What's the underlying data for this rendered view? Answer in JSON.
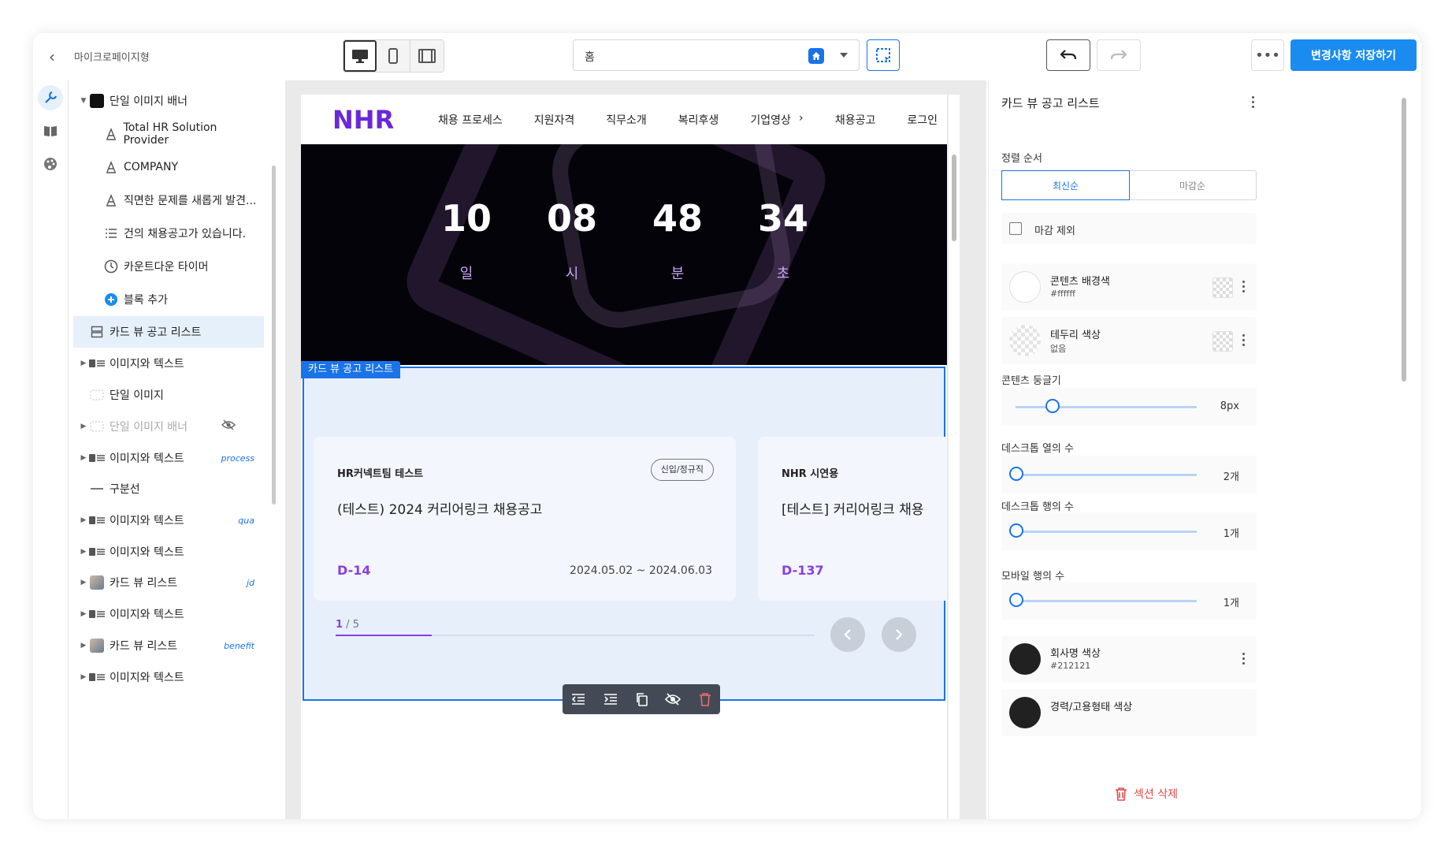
{
  "topbar": {
    "page_name": "마이크로페이지형",
    "page_select": "홈",
    "save_label": "변경사항 저장하기"
  },
  "tree": {
    "items": [
      {
        "label": "단일 이미지 배너",
        "icon": "image-thumbnail-icon"
      },
      {
        "label": "Total HR Solution Provider",
        "icon": "text-icon"
      },
      {
        "label": "COMPANY",
        "icon": "text-icon"
      },
      {
        "label": "직면한 문제를 새롭게 발견...",
        "icon": "text-icon"
      },
      {
        "label": "건의 채용공고가 있습니다.",
        "icon": "list-icon"
      },
      {
        "label": "카운트다운 타이머",
        "icon": "clock-icon"
      },
      {
        "label": "블록 추가",
        "icon": "plus-circle-icon"
      },
      {
        "label": "카드 뷰 공고 리스트",
        "icon": "card-list-icon"
      },
      {
        "label": "이미지와 텍스트",
        "icon": "image-text-icon"
      },
      {
        "label": "단일 이미지",
        "icon": "image-icon"
      },
      {
        "label": "단일 이미지 배너",
        "icon": "image-icon"
      },
      {
        "label": "이미지와 텍스트",
        "icon": "image-text-icon",
        "tag": "process"
      },
      {
        "label": "구분선",
        "icon": "divider-icon"
      },
      {
        "label": "이미지와 텍스트",
        "icon": "image-text-icon",
        "tag": "qua"
      },
      {
        "label": "이미지와 텍스트",
        "icon": "image-text-icon"
      },
      {
        "label": "카드 뷰 리스트",
        "icon": "photo-thumbnail-icon",
        "tag": "jd"
      },
      {
        "label": "이미지와 텍스트",
        "icon": "image-text-icon"
      },
      {
        "label": "카드 뷰 리스트",
        "icon": "photo-thumbnail-icon",
        "tag": "benefit"
      },
      {
        "label": "이미지와 텍스트",
        "icon": "image-text-icon"
      }
    ]
  },
  "site": {
    "logo": "NHR",
    "nav": [
      "채용 프로세스",
      "지원자격",
      "직무소개",
      "복리후생",
      "기업영상",
      "채용공고",
      "로그인"
    ],
    "countdown": [
      {
        "value": "10",
        "unit": "일"
      },
      {
        "value": "08",
        "unit": "시"
      },
      {
        "value": "48",
        "unit": "분"
      },
      {
        "value": "34",
        "unit": "초"
      }
    ],
    "block_label": "카드 뷰 공고 리스트",
    "cards": [
      {
        "company": "HR커넥트팀 테스트",
        "badge": "신입/정규직",
        "title": "(테스트) 2024 커리어링크 채용공고",
        "dday": "D-14",
        "dates": "2024.05.02 ~ 2024.06.03"
      },
      {
        "company": "NHR 시연용",
        "badge": "",
        "title": "[테스트] 커리어링크 채용",
        "dday": "D-137",
        "dates": ""
      }
    ],
    "pager": {
      "current": "1",
      "total": " / 5",
      "progress": 0.2
    }
  },
  "panel": {
    "title": "카드 뷰 공고 리스트",
    "sort_label": "정렬 순서",
    "sort_options": [
      "최신순",
      "마감순"
    ],
    "exclude_closed": "마감 제외",
    "content_bg_name": "콘텐츠 배경색",
    "content_bg_value": "#ffffff",
    "border_color_name": "테두리 색상",
    "border_color_value": "없음",
    "radius_label": "콘텐츠 둥글기",
    "radius_value": "8px",
    "radius_level": 0.2,
    "desktop_cols_label": "데스크톱 열의 수",
    "desktop_cols_value": "2개",
    "desktop_rows_label": "데스크톱 행의 수",
    "desktop_rows_value": "1개",
    "mobile_rows_label": "모바일 행의 수",
    "mobile_rows_value": "1개",
    "company_color_name": "회사명 색상",
    "company_color_value": "#212121",
    "career_color_name": "경력/고용형태 색상",
    "delete_label": "섹션 삭제"
  },
  "colors": {
    "accent": "#1a73e8",
    "purple": "#8a3fe0",
    "save_button": "#1a8cf0",
    "delete": "#e24a4a"
  }
}
